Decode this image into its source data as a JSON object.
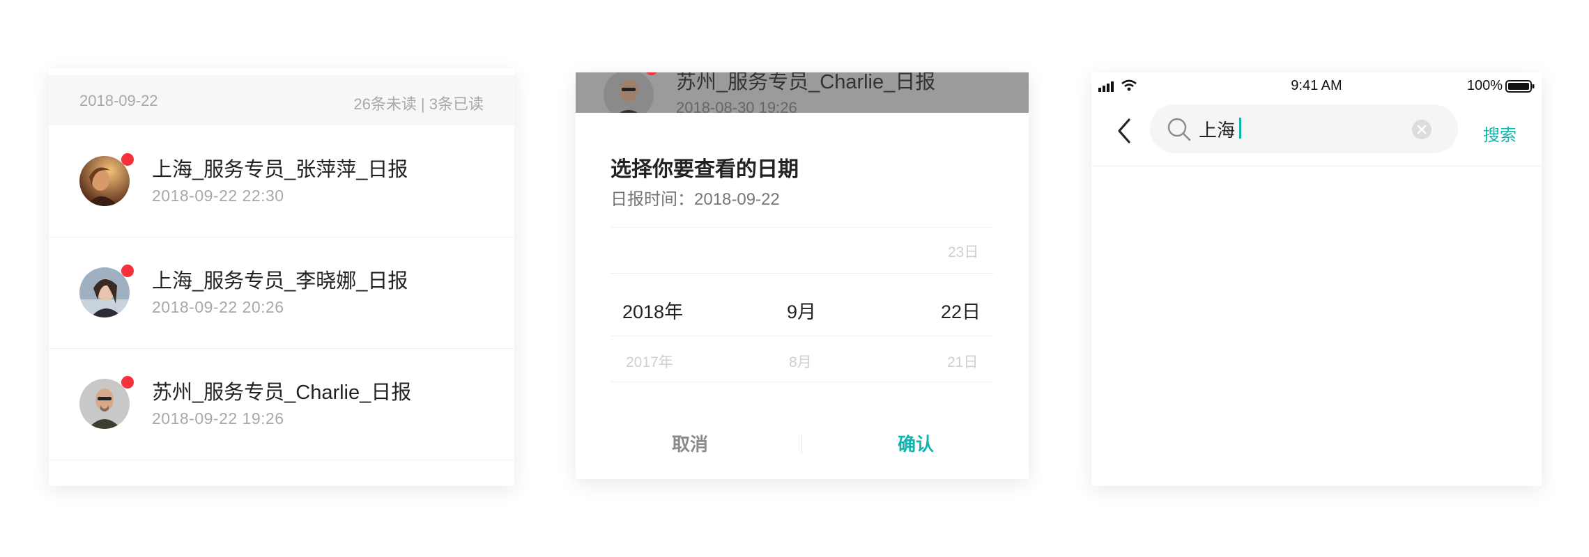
{
  "list": {
    "header_date": "2018-09-22",
    "header_counts": "26条未读 | 3条已读",
    "items": [
      {
        "title": "上海_服务专员_张萍萍_日报",
        "time": "2018-09-22   22:30"
      },
      {
        "title": "上海_服务专员_李晓娜_日报",
        "time": "2018-09-22   20:26"
      },
      {
        "title": "苏州_服务专员_Charlie_日报",
        "time": "2018-09-22   19:26"
      }
    ]
  },
  "picker": {
    "background_item": {
      "title": "苏州_服务专员_Charlie_日报",
      "time": "2018-08-30   19:26"
    },
    "title": "选择你要查看的日期",
    "subtitle": "日报时间：2018-09-22",
    "prev_day": "23日",
    "selected_year": "2018年",
    "selected_month": "9月",
    "selected_day": "22日",
    "next_year": "2017年",
    "next_month": "8月",
    "next_day": "21日",
    "cancel_label": "取消",
    "confirm_label": "确认"
  },
  "search": {
    "status_time": "9:41 AM",
    "battery_text": "100%",
    "query": "上海",
    "action_label": "搜索"
  },
  "colors": {
    "accent": "#10b5b0",
    "unread_dot": "#f5323c"
  }
}
